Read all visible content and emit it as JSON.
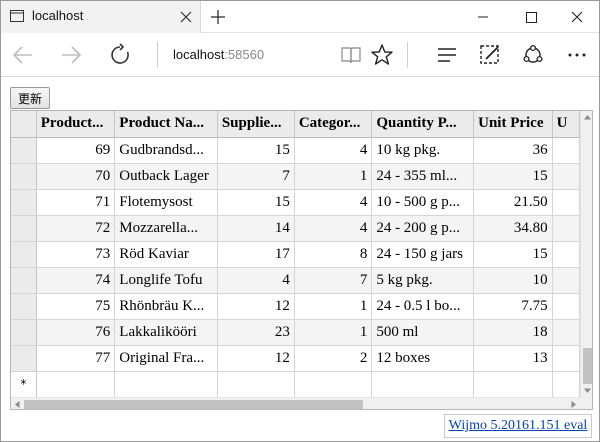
{
  "browser": {
    "tab_title": "localhost",
    "address_host": "localhost",
    "address_port": ":58560"
  },
  "toolbar": {
    "update_label": "更新"
  },
  "grid": {
    "columns": [
      "Product...",
      "Product Na...",
      "Supplie...",
      "Categor...",
      "Quantity P...",
      "Unit Price",
      "U"
    ],
    "rows": [
      [
        "69",
        "Gudbrandsd...",
        "15",
        "4",
        "10 kg pkg.",
        "36"
      ],
      [
        "70",
        "Outback Lager",
        "7",
        "1",
        "24 - 355 ml...",
        "15"
      ],
      [
        "71",
        "Flotemysost",
        "15",
        "4",
        "10 - 500 g p...",
        "21.50"
      ],
      [
        "72",
        "Mozzarella...",
        "14",
        "4",
        "24 - 200 g p...",
        "34.80"
      ],
      [
        "73",
        "Röd Kaviar",
        "17",
        "8",
        "24 - 150 g jars",
        "15"
      ],
      [
        "74",
        "Longlife Tofu",
        "4",
        "7",
        "5 kg pkg.",
        "10"
      ],
      [
        "75",
        "Rhönbräu K...",
        "12",
        "1",
        "24 - 0.5 l bo...",
        "7.75"
      ],
      [
        "76",
        "Lakkalikööri",
        "23",
        "1",
        "500 ml",
        "18"
      ],
      [
        "77",
        "Original Fra...",
        "12",
        "2",
        "12 boxes",
        "13"
      ]
    ],
    "new_row_marker": "*"
  },
  "footer": {
    "wijmo_link": "Wijmo 5.20161.151 eval"
  }
}
